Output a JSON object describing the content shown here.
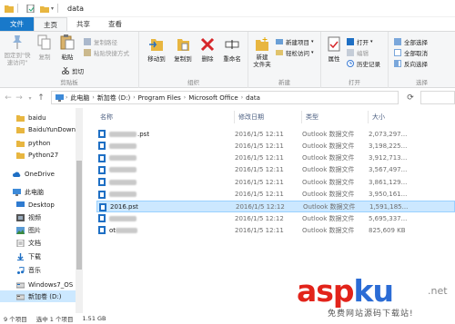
{
  "window": {
    "title": "data"
  },
  "ribbon_tabs": [
    "文件",
    "主页",
    "共享",
    "查看"
  ],
  "ribbon": {
    "clipboard": {
      "group_label": "剪贴板",
      "pin_label": "固定到\"快\n速访问\"",
      "copy_label": "复制",
      "paste_label": "粘贴",
      "cut_label": "剪切",
      "copy_path_label": "复制路径",
      "paste_shortcut_label": "粘贴快捷方式"
    },
    "organize": {
      "group_label": "组织",
      "move_to_label": "移动到",
      "copy_to_label": "复制到",
      "delete_label": "删除",
      "rename_label": "重命名"
    },
    "new": {
      "group_label": "新建",
      "new_folder_label": "新建\n文件夹",
      "new_item_label": "新建项目",
      "easy_access_label": "轻松访问"
    },
    "open": {
      "group_label": "打开",
      "properties_label": "属性",
      "open_label": "打开",
      "edit_label": "编辑",
      "history_label": "历史记录"
    },
    "select": {
      "group_label": "选择",
      "select_all_label": "全部选择",
      "select_none_label": "全部取消",
      "invert_label": "反向选择"
    }
  },
  "address": {
    "crumbs": [
      "此电脑",
      "新加卷 (D:)",
      "Program Files",
      "Microsoft Office",
      "data"
    ]
  },
  "nav_pane": {
    "items": [
      {
        "label": "baidu",
        "icon": "folder-icon"
      },
      {
        "label": "BaiduYunDown",
        "icon": "folder-icon"
      },
      {
        "label": "python",
        "icon": "folder-icon"
      },
      {
        "label": "Python27",
        "icon": "folder-icon"
      },
      {
        "label": "OneDrive",
        "icon": "cloud-icon"
      },
      {
        "label": "此电脑",
        "icon": "computer-icon"
      },
      {
        "label": "Desktop",
        "icon": "desktop-icon"
      },
      {
        "label": "视频",
        "icon": "video-icon"
      },
      {
        "label": "图片",
        "icon": "picture-icon"
      },
      {
        "label": "文档",
        "icon": "document-icon"
      },
      {
        "label": "下载",
        "icon": "download-icon"
      },
      {
        "label": "音乐",
        "icon": "music-icon"
      },
      {
        "label": "Windows7_OS",
        "icon": "drive-icon"
      },
      {
        "label": "新加卷 (D:)",
        "icon": "drive-icon"
      }
    ]
  },
  "file_list": {
    "columns": [
      "名称",
      "修改日期",
      "类型",
      "大小"
    ],
    "rows": [
      {
        "name": ".pst",
        "date": "2016/1/5 12:11",
        "type": "Outlook 数据文件",
        "size": "2,073,297..."
      },
      {
        "name": "",
        "date": "2016/1/5 12:11",
        "type": "Outlook 数据文件",
        "size": "3,198,225..."
      },
      {
        "name": "",
        "date": "2016/1/5 12:11",
        "type": "Outlook 数据文件",
        "size": "3,912,713..."
      },
      {
        "name": "",
        "date": "2016/1/5 12:11",
        "type": "Outlook 数据文件",
        "size": "3,567,497..."
      },
      {
        "name": "",
        "date": "2016/1/5 12:11",
        "type": "Outlook 数据文件",
        "size": "3,861,129..."
      },
      {
        "name": "",
        "date": "2016/1/5 12:11",
        "type": "Outlook 数据文件",
        "size": "3,950,161..."
      },
      {
        "name": "2016.pst",
        "date": "2016/1/5 12:12",
        "type": "Outlook 数据文件",
        "size": "1,591,185..."
      },
      {
        "name": "",
        "date": "2016/1/5 12:12",
        "type": "Outlook 数据文件",
        "size": "5,695,337..."
      },
      {
        "name": "ot",
        "date": "2016/1/5 12:11",
        "type": "Outlook 数据文件",
        "size": "825,609 KB"
      }
    ]
  },
  "status": {
    "item_count": "9 个项目",
    "selected": "选中 1 个项目",
    "size": "1.51 GB"
  },
  "watermark": {
    "main": "aspku",
    "suffix": ".net",
    "sub": "免费网站源码下载站!"
  },
  "colors": {
    "accent": "#1979ca",
    "selection": "#cce8ff",
    "folder": "#e8b640",
    "watermark_red": "#e2231a",
    "watermark_blue": "#2b6cd5"
  }
}
